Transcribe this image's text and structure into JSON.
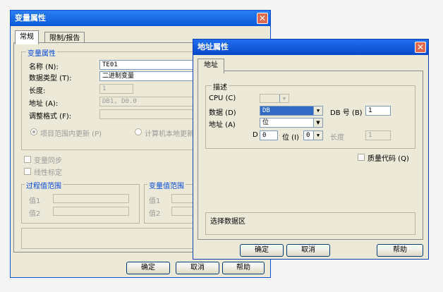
{
  "var_win": {
    "title": "变量属性",
    "tabs": [
      "常规",
      "限制/报告"
    ],
    "group_title": "变量属性",
    "name_label": "名称 (N):",
    "name_value": "TE01",
    "type_label": "数据类型 (T):",
    "type_value": "二进制变量",
    "length_label": "长度:",
    "length_value": "1",
    "address_label": "地址 (A):",
    "address_value": "DB1, D0.0",
    "format_label": "调整格式 (F):",
    "radio_project": "项目范围内更新 (P)",
    "radio_local": "计算机本地更新",
    "chk_sync": "变量同步",
    "chk_linear": "线性标定",
    "process_range": "过程值范围",
    "var_range": "变量值范围",
    "val1": "值1",
    "val2": "值2",
    "ok": "确定",
    "cancel": "取消",
    "help": "帮助"
  },
  "addr_win": {
    "title": "地址属性",
    "tab": "地址",
    "group_title": "描述",
    "cpu_label": "CPU (C)",
    "data_label": "数据 (D)",
    "data_value": "DB",
    "dbno_label": "DB 号 (B)",
    "dbno_value": "1",
    "address_label": "地址 (A)",
    "address_value": "位",
    "d_label": "D",
    "d_value": "0",
    "bit_label": "位 (I)",
    "bit_value": "0",
    "length_label": "长度",
    "length_value": "1",
    "quality_label": "质量代码 (Q)",
    "status_text": "选择数据区",
    "ok": "确定",
    "cancel": "取消",
    "help": "帮助"
  },
  "colors": {
    "title_gradient_start": "#0a5ad8",
    "title_gradient_end": "#2b7ef3",
    "group_label": "#0046d5"
  }
}
